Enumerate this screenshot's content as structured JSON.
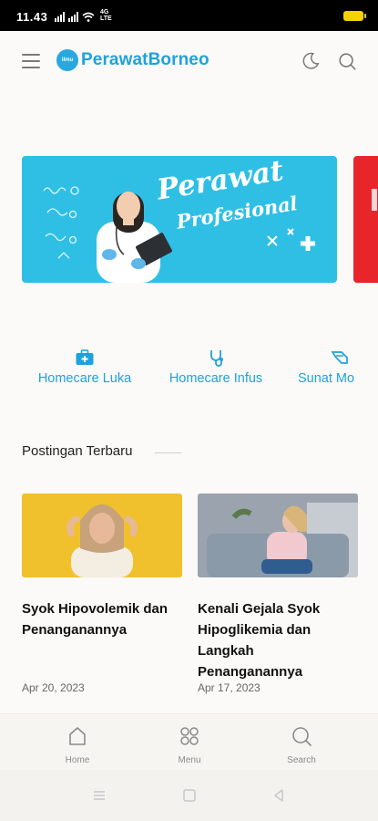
{
  "status_bar": {
    "time": "11.43",
    "lte_label": "4G LTE"
  },
  "header": {
    "logo_badge": "ilmu",
    "logo_text": "PerawatBorneo",
    "icons": [
      "menu-icon",
      "moon-icon",
      "search-icon"
    ]
  },
  "banner": {
    "title_line1": "Perawat",
    "title_line2": "Profesional"
  },
  "shortcuts": [
    {
      "label": "Homecare Luka",
      "icon": "first-aid-kit-icon"
    },
    {
      "label": "Homecare Infus",
      "icon": "stethoscope-icon"
    },
    {
      "label": "Sunat Mo",
      "icon": "scissors-icon"
    }
  ],
  "recent": {
    "section_title": "Postingan Terbaru",
    "posts": [
      {
        "title": "Syok Hipovolemik dan Penanganannya",
        "date": "Apr 20, 2023"
      },
      {
        "title": "Kenali Gejala Syok Hipoglikemia dan Langkah Penanganannya",
        "date": "Apr 17, 2023"
      }
    ]
  },
  "bottom_nav": [
    {
      "label": "Home",
      "icon": "home-icon"
    },
    {
      "label": "Menu",
      "icon": "grid-icon"
    },
    {
      "label": "Search",
      "icon": "search-icon"
    }
  ],
  "colors": {
    "brand": "#1fa2db",
    "banner_bg": "#2fbfe5",
    "banner_next": "#e8252b",
    "battery": "#f5d100"
  }
}
